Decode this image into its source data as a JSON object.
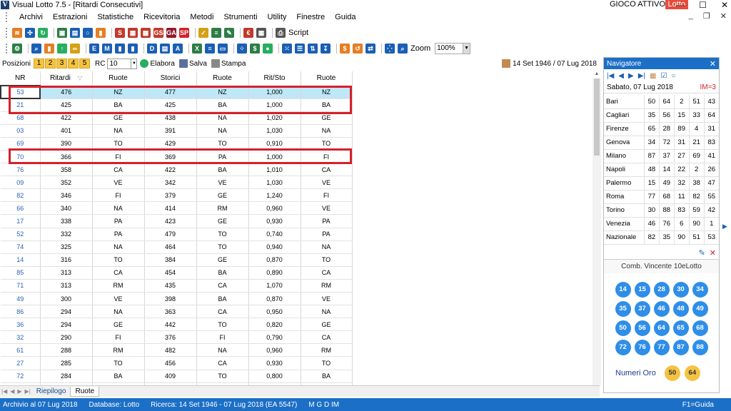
{
  "window": {
    "title": "Visual Lotto 7.5 - [Ritardi Consecutivi]",
    "app_icon": "V",
    "gioco_attivo": "GIOCO ATTIVO",
    "game_badge": "Lotto",
    "minimize": "—",
    "maximize": "☐",
    "close": "✕"
  },
  "menu": [
    "Archivi",
    "Estrazioni",
    "Statistiche",
    "Ricevitoria",
    "Metodi",
    "Strumenti",
    "Utility",
    "Finestre",
    "Guida"
  ],
  "mdi": {
    "minimize": "_",
    "restore": "❐",
    "close": "✕"
  },
  "toolbar1": {
    "icons": [
      {
        "name": "rss-icon",
        "color": "#e67e22",
        "glyph": "≋"
      },
      {
        "name": "network-icon",
        "color": "#1a5fb4",
        "glyph": "✣"
      },
      {
        "name": "refresh-icon",
        "color": "#27ae60",
        "glyph": "↻"
      },
      {
        "name": "calendar-check-icon",
        "color": "#2d7d46",
        "glyph": "▦"
      },
      {
        "name": "card-icon",
        "color": "#1a5fb4",
        "glyph": "▤"
      },
      {
        "name": "circle-icon",
        "color": "#1a5fb4",
        "glyph": "○"
      },
      {
        "name": "bar-chart-icon",
        "color": "#e67e22",
        "glyph": "▮"
      },
      {
        "name": "s-grid-icon",
        "color": "#c0392b",
        "glyph": "S"
      },
      {
        "name": "grid-icon",
        "color": "#c0392b",
        "glyph": "▦"
      },
      {
        "name": "calendar-icon",
        "color": "#c0392b",
        "glyph": "▩"
      },
      {
        "name": "gs-icon",
        "color": "#c0392b",
        "glyph": "GS"
      },
      {
        "name": "ga-icon",
        "color": "#8e1b2b",
        "glyph": "GA"
      },
      {
        "name": "sp-icon",
        "color": "#d6202a",
        "glyph": "SP"
      },
      {
        "name": "checklist-icon",
        "color": "#d4a017",
        "glyph": "✓"
      },
      {
        "name": "notes-icon",
        "color": "#2d7d46",
        "glyph": "≡"
      },
      {
        "name": "edit-icon",
        "color": "#2d7d46",
        "glyph": "✎"
      },
      {
        "name": "euro-icon",
        "color": "#c0392b",
        "glyph": "€"
      },
      {
        "name": "calculator-icon",
        "color": "#555555",
        "glyph": "▦"
      },
      {
        "name": "printer-icon",
        "color": "#555555",
        "glyph": "⎙"
      }
    ],
    "script_label": "Script"
  },
  "toolbar2": {
    "icons": [
      {
        "name": "settings-icon",
        "color": "#2d7d46",
        "glyph": "⚙"
      },
      {
        "name": "magnifier-chart-icon",
        "color": "#1a5fb4",
        "glyph": "⌕"
      },
      {
        "name": "bar-chart-icon",
        "color": "#e67e22",
        "glyph": "▮"
      },
      {
        "name": "up-arrow-icon",
        "color": "#27ae60",
        "glyph": "↑"
      },
      {
        "name": "link-icon",
        "color": "#d4a017",
        "glyph": "∞"
      },
      {
        "name": "e-icon",
        "color": "#1a5fb4",
        "glyph": "E"
      },
      {
        "name": "m-icon",
        "color": "#1a5fb4",
        "glyph": "M"
      },
      {
        "name": "bars-icon",
        "color": "#1a5fb4",
        "glyph": "▮"
      },
      {
        "name": "columns-icon",
        "color": "#1a5fb4",
        "glyph": "▮"
      },
      {
        "name": "d-icon",
        "color": "#1a5fb4",
        "glyph": "D"
      },
      {
        "name": "table-icon",
        "color": "#1a5fb4",
        "glyph": "▤"
      },
      {
        "name": "a-icon",
        "color": "#1a5fb4",
        "glyph": "A"
      },
      {
        "name": "excel-icon",
        "color": "#2d7d46",
        "glyph": "X"
      },
      {
        "name": "list-icon",
        "color": "#1a5fb4",
        "glyph": "≡"
      },
      {
        "name": "window-icon",
        "color": "#1a5fb4",
        "glyph": "▭"
      },
      {
        "name": "dots-icon",
        "color": "#1a5fb4",
        "glyph": "⁘"
      },
      {
        "name": "dollar-icon",
        "color": "#2d7d46",
        "glyph": "$"
      },
      {
        "name": "green-circle-icon",
        "color": "#27ae60",
        "glyph": "●"
      },
      {
        "name": "grid-dots-icon",
        "color": "#1a5fb4",
        "glyph": "⁙"
      },
      {
        "name": "list-lines-icon",
        "color": "#1a5fb4",
        "glyph": "☰"
      },
      {
        "name": "sort-icon",
        "color": "#1a5fb4",
        "glyph": "⇅"
      },
      {
        "name": "sort-desc-icon",
        "color": "#1a5fb4",
        "glyph": "↧"
      },
      {
        "name": "dollar-circle-icon",
        "color": "#e67e22",
        "glyph": "$"
      },
      {
        "name": "cycle-icon",
        "color": "#e67e22",
        "glyph": "↺"
      },
      {
        "name": "swap-icon",
        "color": "#1a5fb4",
        "glyph": "⇄"
      },
      {
        "name": "network-dots-icon",
        "color": "#1a5fb4",
        "glyph": "⁛"
      },
      {
        "name": "zoom-icon",
        "color": "#1a5fb4",
        "glyph": "⌕"
      }
    ],
    "zoom_label": "Zoom",
    "zoom_value": "100%"
  },
  "posbar": {
    "label": "Posizioni",
    "positions": [
      "1",
      "2",
      "3",
      "4",
      "5"
    ],
    "rc_label": "RC",
    "rc_value": "10",
    "elabora": "Elabora",
    "salva": "Salva",
    "stampa": "Stampa",
    "date_range": "14 Set 1946 / 07 Lug 2018"
  },
  "grid": {
    "headers": [
      "NR",
      "Ritardi",
      "Ruote",
      "Storici",
      "Ruote",
      "Rit/Sto",
      "Ruote"
    ],
    "sort_indicator": "▽",
    "rows": [
      [
        "53",
        "476",
        "NZ",
        "477",
        "NZ",
        "1,000",
        "NZ"
      ],
      [
        "21",
        "425",
        "BA",
        "425",
        "BA",
        "1,000",
        "BA"
      ],
      [
        "68",
        "422",
        "GE",
        "438",
        "NA",
        "1,020",
        "GE"
      ],
      [
        "03",
        "401",
        "NA",
        "391",
        "NA",
        "1,030",
        "NA"
      ],
      [
        "69",
        "390",
        "TO",
        "429",
        "TO",
        "0,910",
        "TO"
      ],
      [
        "70",
        "366",
        "FI",
        "369",
        "PA",
        "1,000",
        "FI"
      ],
      [
        "76",
        "358",
        "CA",
        "422",
        "BA",
        "1,010",
        "CA"
      ],
      [
        "09",
        "352",
        "VE",
        "342",
        "VE",
        "1,030",
        "VE"
      ],
      [
        "82",
        "346",
        "FI",
        "379",
        "GE",
        "1,240",
        "FI"
      ],
      [
        "66",
        "340",
        "NA",
        "414",
        "RM",
        "0,960",
        "VE"
      ],
      [
        "17",
        "338",
        "PA",
        "423",
        "GE",
        "0,930",
        "PA"
      ],
      [
        "52",
        "332",
        "PA",
        "479",
        "TO",
        "0,740",
        "PA"
      ],
      [
        "74",
        "325",
        "NA",
        "464",
        "TO",
        "0,940",
        "NA"
      ],
      [
        "14",
        "316",
        "TO",
        "384",
        "GE",
        "0,870",
        "TO"
      ],
      [
        "85",
        "313",
        "CA",
        "454",
        "BA",
        "0,890",
        "CA"
      ],
      [
        "71",
        "313",
        "RM",
        "435",
        "CA",
        "1,070",
        "RM"
      ],
      [
        "49",
        "300",
        "VE",
        "398",
        "BA",
        "0,870",
        "VE"
      ],
      [
        "86",
        "294",
        "NA",
        "363",
        "CA",
        "0,950",
        "NA"
      ],
      [
        "36",
        "294",
        "GE",
        "442",
        "TO",
        "0,820",
        "GE"
      ],
      [
        "32",
        "290",
        "FI",
        "376",
        "FI",
        "0,790",
        "CA"
      ],
      [
        "61",
        "288",
        "RM",
        "482",
        "NA",
        "0,960",
        "RM"
      ],
      [
        "27",
        "285",
        "TO",
        "456",
        "CA",
        "0,930",
        "TO"
      ],
      [
        "72",
        "284",
        "BA",
        "409",
        "TO",
        "0,800",
        "BA"
      ],
      [
        "",
        "",
        "",
        "",
        "",
        "",
        ""
      ]
    ]
  },
  "tabs": [
    "Riepilogo",
    "Ruote"
  ],
  "tab_nav": [
    "|◀",
    "◀",
    "▶",
    "▶|"
  ],
  "statusbar": {
    "archivio": "Archivio al 07 Lug 2018",
    "database": "Database: Lotto",
    "ricerca": "Ricerca:  14 Set 1946 - 07 Lug 2018 (EA 5547)",
    "flags": "M   G   D   IM",
    "help": "F1=Guida"
  },
  "navigator": {
    "title": "Navigatore",
    "date": "Sabato, 07 Lug 2018",
    "im": "IM=3",
    "draws": [
      {
        "city": "Bari",
        "nums": [
          "50",
          "64",
          "2",
          "51",
          "43"
        ]
      },
      {
        "city": "Cagliari",
        "nums": [
          "35",
          "56",
          "15",
          "33",
          "64"
        ]
      },
      {
        "city": "Firenze",
        "nums": [
          "65",
          "28",
          "89",
          "4",
          "31"
        ]
      },
      {
        "city": "Genova",
        "nums": [
          "34",
          "72",
          "31",
          "21",
          "83"
        ]
      },
      {
        "city": "Milano",
        "nums": [
          "87",
          "37",
          "27",
          "69",
          "41"
        ]
      },
      {
        "city": "Napoli",
        "nums": [
          "48",
          "14",
          "22",
          "2",
          "26"
        ]
      },
      {
        "city": "Palermo",
        "nums": [
          "15",
          "49",
          "32",
          "38",
          "47"
        ]
      },
      {
        "city": "Roma",
        "nums": [
          "77",
          "68",
          "11",
          "82",
          "55"
        ]
      },
      {
        "city": "Torino",
        "nums": [
          "30",
          "88",
          "83",
          "59",
          "42"
        ]
      },
      {
        "city": "Venezia",
        "nums": [
          "46",
          "76",
          "6",
          "90",
          "1"
        ]
      },
      {
        "city": "Nazionale",
        "nums": [
          "82",
          "35",
          "90",
          "51",
          "53"
        ]
      }
    ],
    "comb_title": "Comb. Vincente 10eLotto",
    "balls": [
      "14",
      "15",
      "28",
      "30",
      "34",
      "35",
      "37",
      "46",
      "48",
      "49",
      "50",
      "56",
      "64",
      "65",
      "68",
      "72",
      "76",
      "77",
      "87",
      "88"
    ],
    "oro_label": "Numeri Oro",
    "oro": [
      "50",
      "64"
    ]
  }
}
